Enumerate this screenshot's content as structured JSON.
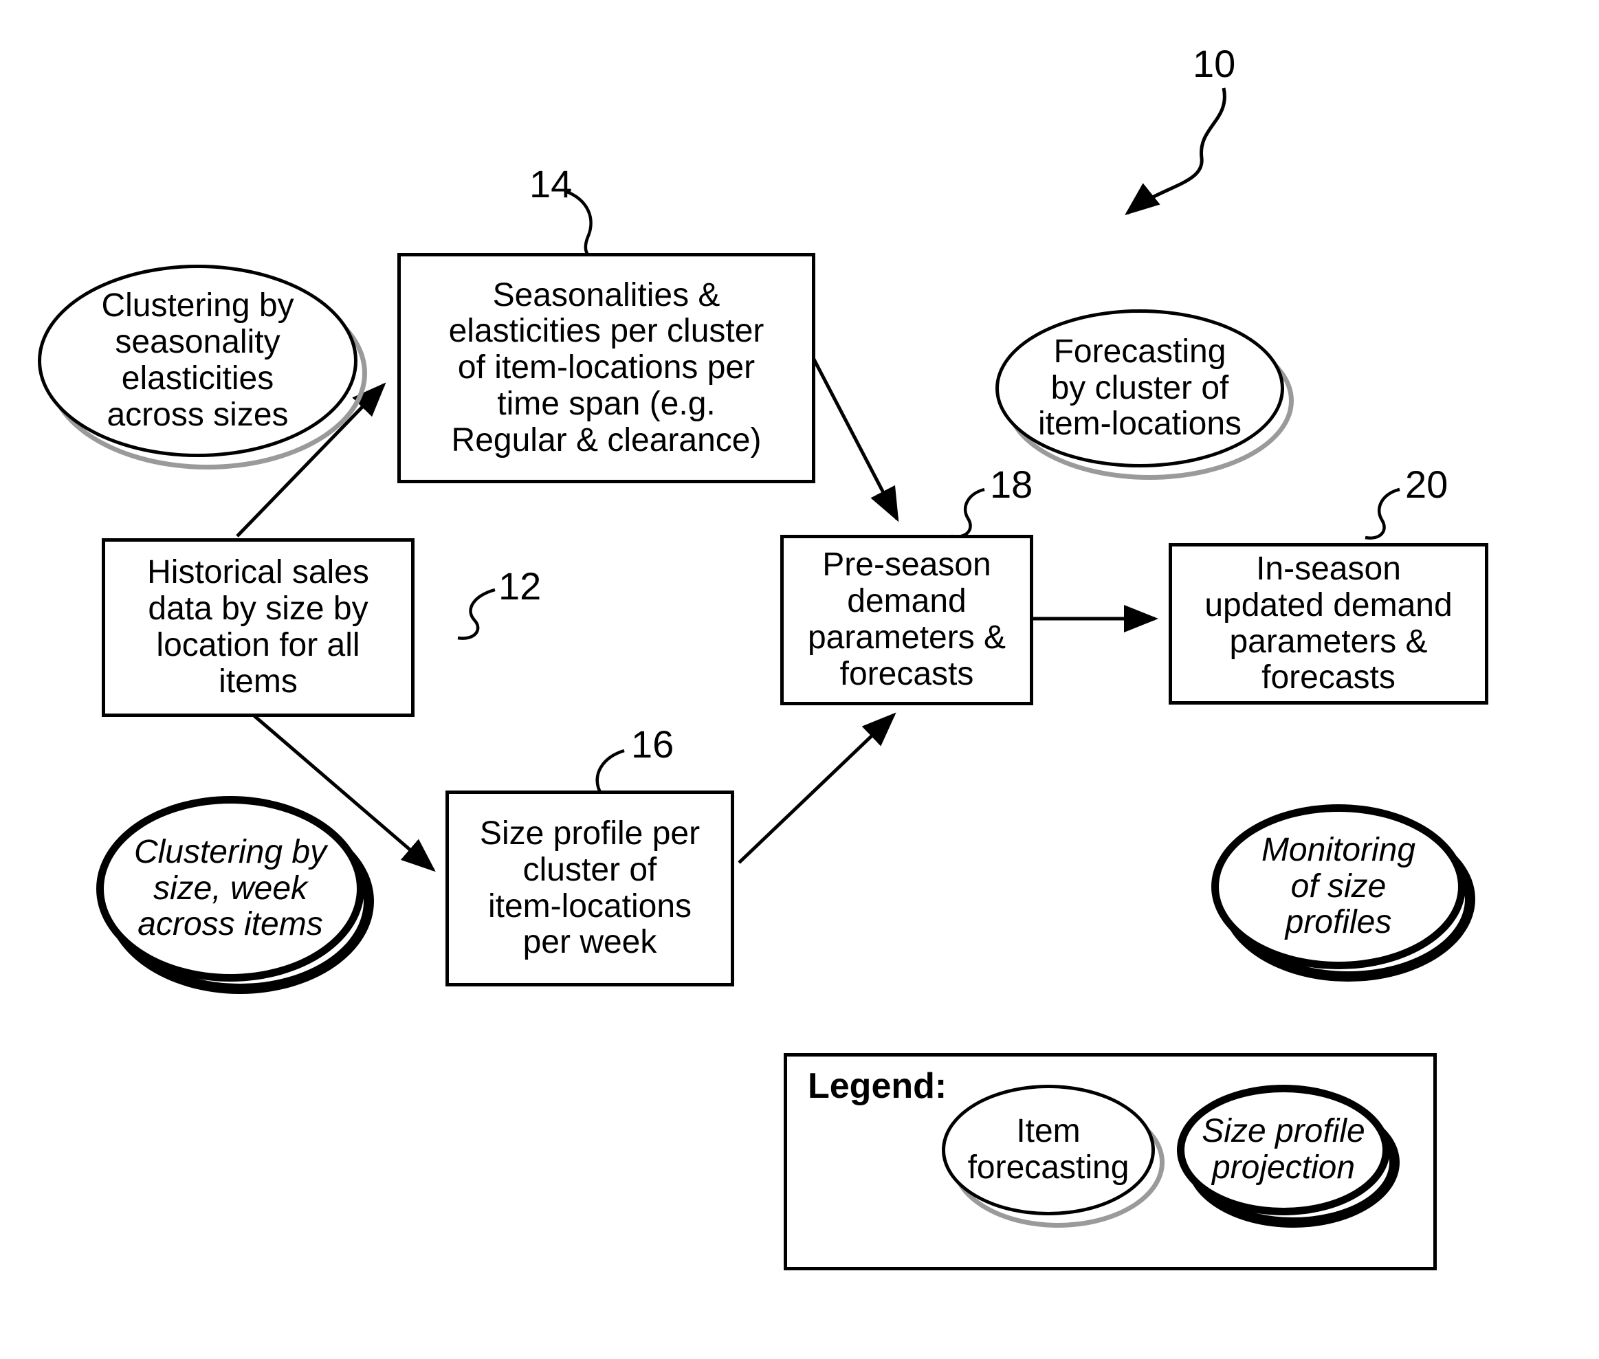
{
  "figure": {
    "ref_main": "10",
    "refs": {
      "historical": "12",
      "seasonalities": "14",
      "size_profile": "16",
      "preseason": "18",
      "inseason": "20"
    }
  },
  "nodes": {
    "clustering_seasonality": {
      "kind": "ellipse-item-forecasting",
      "lines": [
        "Clustering by",
        "seasonality",
        "elasticities",
        "across sizes"
      ]
    },
    "seasonalities_box": {
      "kind": "box",
      "ref": "14",
      "lines": [
        "Seasonalities &",
        "elasticities per cluster",
        "of item-locations per",
        "time span (e.g.",
        "Regular & clearance)"
      ]
    },
    "historical_box": {
      "kind": "box",
      "ref": "12",
      "lines": [
        "Historical sales",
        "data by size by",
        "location for all",
        "items"
      ]
    },
    "clustering_size_week": {
      "kind": "ellipse-size-profile",
      "lines": [
        "Clustering by",
        "size, week",
        "across items"
      ]
    },
    "size_profile_box": {
      "kind": "box",
      "ref": "16",
      "lines": [
        "Size profile per",
        "cluster of",
        "item-locations",
        "per week"
      ]
    },
    "forecasting_cluster": {
      "kind": "ellipse-item-forecasting",
      "lines": [
        "Forecasting",
        "by cluster of",
        "item-locations"
      ]
    },
    "preseason_box": {
      "kind": "box",
      "ref": "18",
      "lines": [
        "Pre-season",
        "demand",
        "parameters &",
        "forecasts"
      ]
    },
    "inseason_box": {
      "kind": "box",
      "ref": "20",
      "lines": [
        "In-season",
        "updated demand",
        "parameters &",
        "forecasts"
      ]
    },
    "monitoring": {
      "kind": "ellipse-size-profile",
      "lines": [
        "Monitoring",
        "of size",
        "profiles"
      ]
    }
  },
  "legend": {
    "title": "Legend:",
    "item_forecasting": {
      "kind": "ellipse-item-forecasting",
      "lines": [
        "Item",
        "forecasting"
      ]
    },
    "size_profile_projection": {
      "kind": "ellipse-size-profile",
      "lines": [
        "Size profile",
        "projection"
      ]
    }
  },
  "colors": {
    "stroke": "#000000",
    "light_shadow": "#9a9a9a",
    "heavy_shadow": "#000000",
    "background": "#ffffff"
  }
}
